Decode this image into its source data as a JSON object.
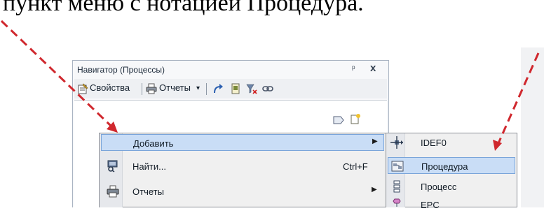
{
  "doc": {
    "caption_fragment": "пункт меню с нотацией Процедура."
  },
  "navigator": {
    "title": "Навигатор (Процессы)",
    "pin_symbol": "ᵖ",
    "close_symbol": "x",
    "toolbar": {
      "properties_label": "Свойства",
      "reports_label": "Отчеты",
      "reports_dropdown": "▾"
    }
  },
  "context_menu": {
    "items": [
      {
        "label": "Добавить",
        "shortcut": "",
        "submenu": true,
        "highlighted": true,
        "icon": "none"
      },
      {
        "label": "Найти...",
        "shortcut": "Ctrl+F",
        "submenu": false,
        "highlighted": false,
        "icon": "find-icon"
      },
      {
        "label": "Отчеты",
        "shortcut": "",
        "submenu": true,
        "highlighted": false,
        "icon": "printer-icon"
      }
    ],
    "submenu_arrow": "▶"
  },
  "submenu": {
    "items": [
      {
        "label": "IDEF0",
        "highlighted": false,
        "icon": "idef0-icon"
      },
      {
        "label": "Процедура",
        "highlighted": true,
        "icon": "procedure-icon"
      },
      {
        "label": "Процесс",
        "highlighted": false,
        "icon": "process-icon"
      },
      {
        "label": "EPC",
        "highlighted": false,
        "icon": "epc-icon"
      }
    ]
  },
  "colors": {
    "annotation_arrow": "#d0282e",
    "highlight_bg": "#c9ddf6",
    "highlight_border": "#7aa5da"
  }
}
